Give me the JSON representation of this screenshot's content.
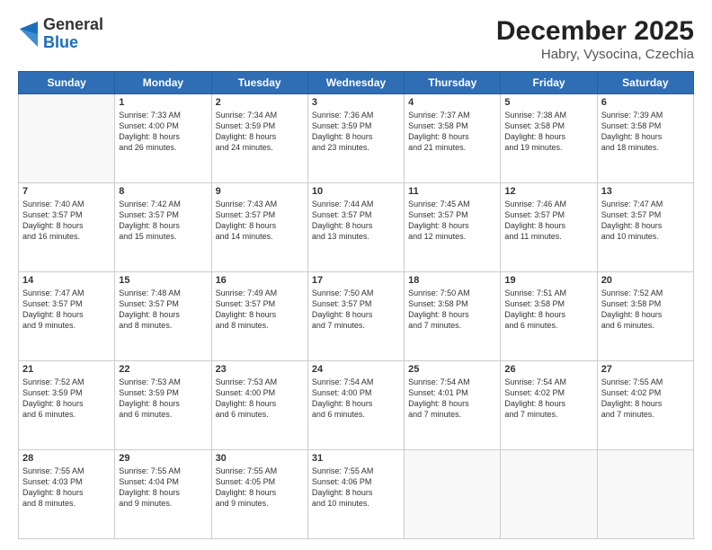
{
  "logo": {
    "line1": "General",
    "line2": "Blue"
  },
  "title": "December 2025",
  "subtitle": "Habry, Vysocina, Czechia",
  "weekdays": [
    "Sunday",
    "Monday",
    "Tuesday",
    "Wednesday",
    "Thursday",
    "Friday",
    "Saturday"
  ],
  "weeks": [
    [
      {
        "day": "",
        "info": ""
      },
      {
        "day": "1",
        "info": "Sunrise: 7:33 AM\nSunset: 4:00 PM\nDaylight: 8 hours\nand 26 minutes."
      },
      {
        "day": "2",
        "info": "Sunrise: 7:34 AM\nSunset: 3:59 PM\nDaylight: 8 hours\nand 24 minutes."
      },
      {
        "day": "3",
        "info": "Sunrise: 7:36 AM\nSunset: 3:59 PM\nDaylight: 8 hours\nand 23 minutes."
      },
      {
        "day": "4",
        "info": "Sunrise: 7:37 AM\nSunset: 3:58 PM\nDaylight: 8 hours\nand 21 minutes."
      },
      {
        "day": "5",
        "info": "Sunrise: 7:38 AM\nSunset: 3:58 PM\nDaylight: 8 hours\nand 19 minutes."
      },
      {
        "day": "6",
        "info": "Sunrise: 7:39 AM\nSunset: 3:58 PM\nDaylight: 8 hours\nand 18 minutes."
      }
    ],
    [
      {
        "day": "7",
        "info": "Sunrise: 7:40 AM\nSunset: 3:57 PM\nDaylight: 8 hours\nand 16 minutes."
      },
      {
        "day": "8",
        "info": "Sunrise: 7:42 AM\nSunset: 3:57 PM\nDaylight: 8 hours\nand 15 minutes."
      },
      {
        "day": "9",
        "info": "Sunrise: 7:43 AM\nSunset: 3:57 PM\nDaylight: 8 hours\nand 14 minutes."
      },
      {
        "day": "10",
        "info": "Sunrise: 7:44 AM\nSunset: 3:57 PM\nDaylight: 8 hours\nand 13 minutes."
      },
      {
        "day": "11",
        "info": "Sunrise: 7:45 AM\nSunset: 3:57 PM\nDaylight: 8 hours\nand 12 minutes."
      },
      {
        "day": "12",
        "info": "Sunrise: 7:46 AM\nSunset: 3:57 PM\nDaylight: 8 hours\nand 11 minutes."
      },
      {
        "day": "13",
        "info": "Sunrise: 7:47 AM\nSunset: 3:57 PM\nDaylight: 8 hours\nand 10 minutes."
      }
    ],
    [
      {
        "day": "14",
        "info": "Sunrise: 7:47 AM\nSunset: 3:57 PM\nDaylight: 8 hours\nand 9 minutes."
      },
      {
        "day": "15",
        "info": "Sunrise: 7:48 AM\nSunset: 3:57 PM\nDaylight: 8 hours\nand 8 minutes."
      },
      {
        "day": "16",
        "info": "Sunrise: 7:49 AM\nSunset: 3:57 PM\nDaylight: 8 hours\nand 8 minutes."
      },
      {
        "day": "17",
        "info": "Sunrise: 7:50 AM\nSunset: 3:57 PM\nDaylight: 8 hours\nand 7 minutes."
      },
      {
        "day": "18",
        "info": "Sunrise: 7:50 AM\nSunset: 3:58 PM\nDaylight: 8 hours\nand 7 minutes."
      },
      {
        "day": "19",
        "info": "Sunrise: 7:51 AM\nSunset: 3:58 PM\nDaylight: 8 hours\nand 6 minutes."
      },
      {
        "day": "20",
        "info": "Sunrise: 7:52 AM\nSunset: 3:58 PM\nDaylight: 8 hours\nand 6 minutes."
      }
    ],
    [
      {
        "day": "21",
        "info": "Sunrise: 7:52 AM\nSunset: 3:59 PM\nDaylight: 8 hours\nand 6 minutes."
      },
      {
        "day": "22",
        "info": "Sunrise: 7:53 AM\nSunset: 3:59 PM\nDaylight: 8 hours\nand 6 minutes."
      },
      {
        "day": "23",
        "info": "Sunrise: 7:53 AM\nSunset: 4:00 PM\nDaylight: 8 hours\nand 6 minutes."
      },
      {
        "day": "24",
        "info": "Sunrise: 7:54 AM\nSunset: 4:00 PM\nDaylight: 8 hours\nand 6 minutes."
      },
      {
        "day": "25",
        "info": "Sunrise: 7:54 AM\nSunset: 4:01 PM\nDaylight: 8 hours\nand 7 minutes."
      },
      {
        "day": "26",
        "info": "Sunrise: 7:54 AM\nSunset: 4:02 PM\nDaylight: 8 hours\nand 7 minutes."
      },
      {
        "day": "27",
        "info": "Sunrise: 7:55 AM\nSunset: 4:02 PM\nDaylight: 8 hours\nand 7 minutes."
      }
    ],
    [
      {
        "day": "28",
        "info": "Sunrise: 7:55 AM\nSunset: 4:03 PM\nDaylight: 8 hours\nand 8 minutes."
      },
      {
        "day": "29",
        "info": "Sunrise: 7:55 AM\nSunset: 4:04 PM\nDaylight: 8 hours\nand 9 minutes."
      },
      {
        "day": "30",
        "info": "Sunrise: 7:55 AM\nSunset: 4:05 PM\nDaylight: 8 hours\nand 9 minutes."
      },
      {
        "day": "31",
        "info": "Sunrise: 7:55 AM\nSunset: 4:06 PM\nDaylight: 8 hours\nand 10 minutes."
      },
      {
        "day": "",
        "info": ""
      },
      {
        "day": "",
        "info": ""
      },
      {
        "day": "",
        "info": ""
      }
    ]
  ]
}
